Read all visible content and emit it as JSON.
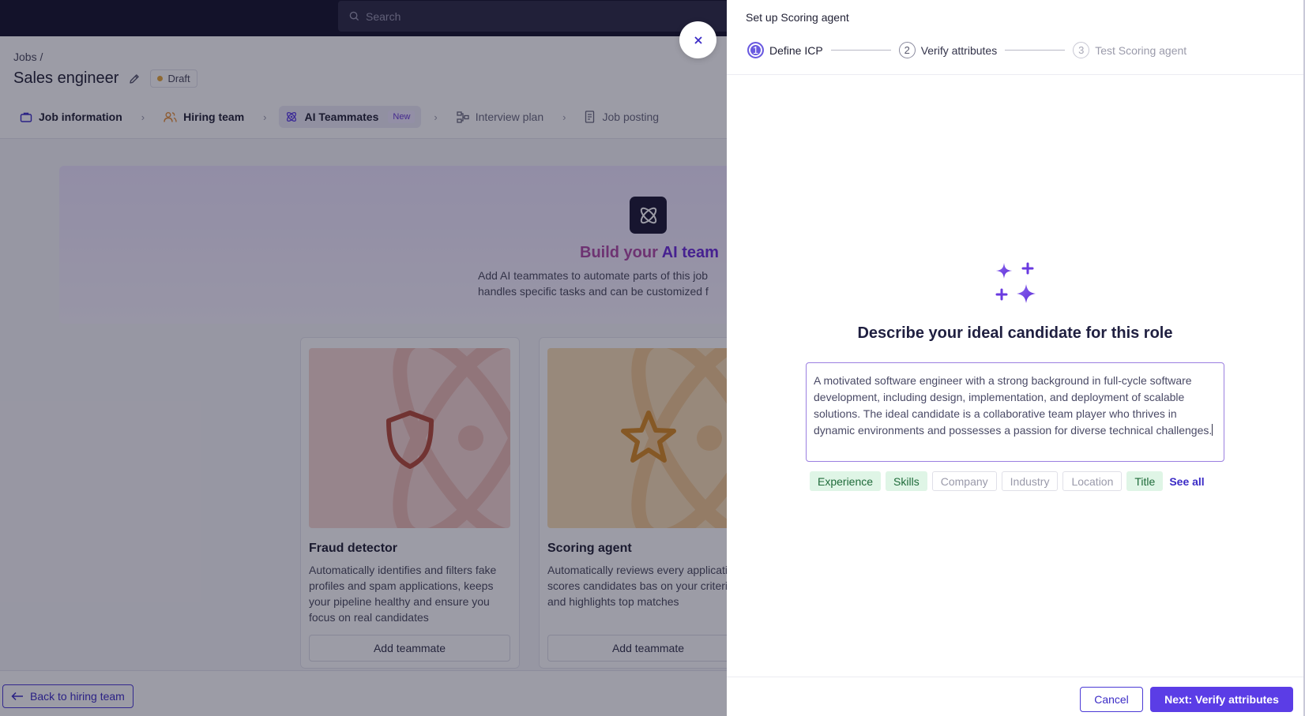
{
  "topbar": {
    "search_placeholder": "Search"
  },
  "header": {
    "breadcrumb": "Jobs /",
    "job_title": "Sales engineer",
    "status_badge": "Draft",
    "steps": [
      {
        "label": "Job information"
      },
      {
        "label": "Hiring team"
      },
      {
        "label": "AI Teammates",
        "tag": "New"
      },
      {
        "label": "Interview plan"
      },
      {
        "label": "Job posting"
      }
    ]
  },
  "hero": {
    "title_part1": "Build your ",
    "title_part2": "AI team",
    "subtitle_line1": "Add AI teammates to automate parts of this job",
    "subtitle_line2": "handles specific tasks and can be customized f"
  },
  "cards": [
    {
      "title": "Fraud detector",
      "description": "Automatically identifies and filters fake profiles and spam applications, keeps your pipeline healthy and ensure you focus on real candidates",
      "button": "Add teammate"
    },
    {
      "title": "Scoring agent",
      "description": "Automatically reviews every application, scores candidates bas on your criteria, and highlights top matches",
      "button": "Add teammate"
    }
  ],
  "footer": {
    "back_label": "Back to hiring team"
  },
  "drawer": {
    "title": "Set up Scoring agent",
    "wizard": [
      {
        "num": "1",
        "label": "Define ICP"
      },
      {
        "num": "2",
        "label": "Verify attributes"
      },
      {
        "num": "3",
        "label": "Test Scoring agent"
      }
    ],
    "heading": "Describe your ideal candidate for this role",
    "icp_text": "A motivated software engineer with a strong background in full-cycle software development, including design, implementation, and deployment of scalable solutions. The ideal candidate is a collaborative team player who thrives in dynamic environments and possesses a passion for diverse technical challenges.",
    "tags": [
      {
        "label": "Experience",
        "state": "on"
      },
      {
        "label": "Skills",
        "state": "on"
      },
      {
        "label": "Company",
        "state": "off"
      },
      {
        "label": "Industry",
        "state": "off"
      },
      {
        "label": "Location",
        "state": "off"
      },
      {
        "label": "Title",
        "state": "on"
      }
    ],
    "see_all": "See all",
    "cancel": "Cancel",
    "next": "Next: Verify attributes"
  },
  "colors": {
    "accent": "#5b3de6",
    "accent_text": "#3b2bc6",
    "tag_on_bg": "#dff5e6",
    "draft_dot": "#e7a83a"
  }
}
